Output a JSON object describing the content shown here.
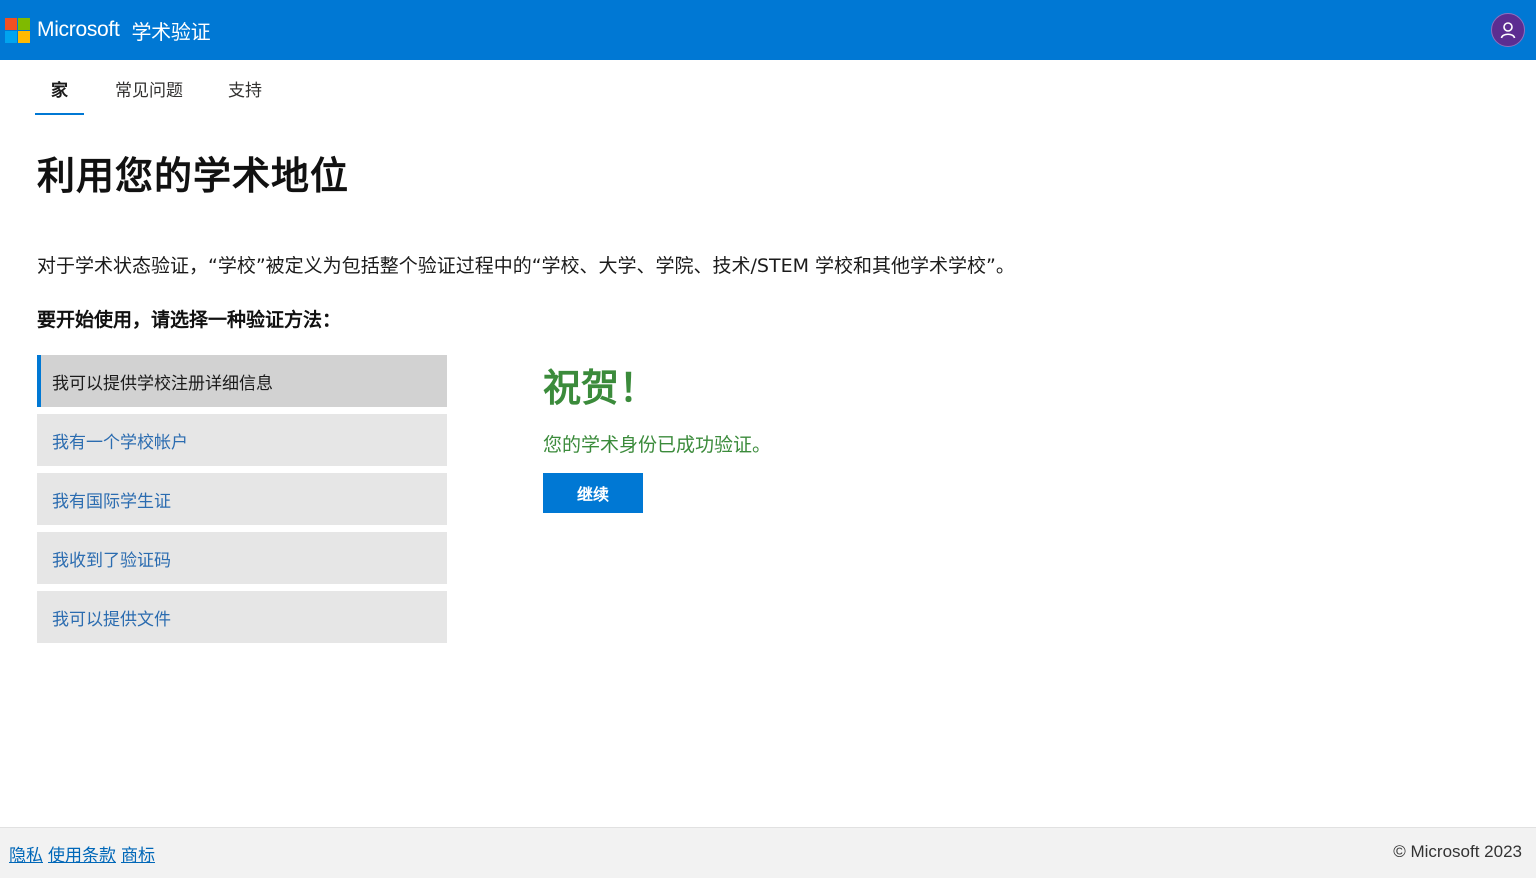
{
  "header": {
    "brand": "Microsoft",
    "product": "学术验证",
    "logo_colors": [
      "#f25022",
      "#7fba00",
      "#00a4ef",
      "#ffb900"
    ],
    "avatar_icon": "user-icon"
  },
  "nav": {
    "tabs": [
      {
        "label": "家",
        "active": true
      },
      {
        "label": "常见问题",
        "active": false
      },
      {
        "label": "支持",
        "active": false
      }
    ]
  },
  "main": {
    "title": "利用您的学术地位",
    "intro": "对于学术状态验证，“学校”被定义为包括整个验证过程中的“学校、大学、学院、技术/STEM 学校和其他学术学校”。",
    "prompt": "要开始使用，请选择一种验证方法：",
    "methods": [
      {
        "label": "我可以提供学校注册详细信息",
        "selected": true
      },
      {
        "label": "我有一个学校帐户",
        "selected": false
      },
      {
        "label": "我有国际学生证",
        "selected": false
      },
      {
        "label": "我收到了验证码",
        "selected": false
      },
      {
        "label": "我可以提供文件",
        "selected": false
      }
    ],
    "result": {
      "heading": "祝贺！",
      "message": "您的学术身份已成功验证。",
      "continue_label": "继续"
    }
  },
  "footer": {
    "links": [
      "隐私",
      "使用条款",
      "商标"
    ],
    "copyright": "© Microsoft 2023"
  },
  "colors": {
    "accent": "#0078d4",
    "success": "#3b8b3b"
  }
}
